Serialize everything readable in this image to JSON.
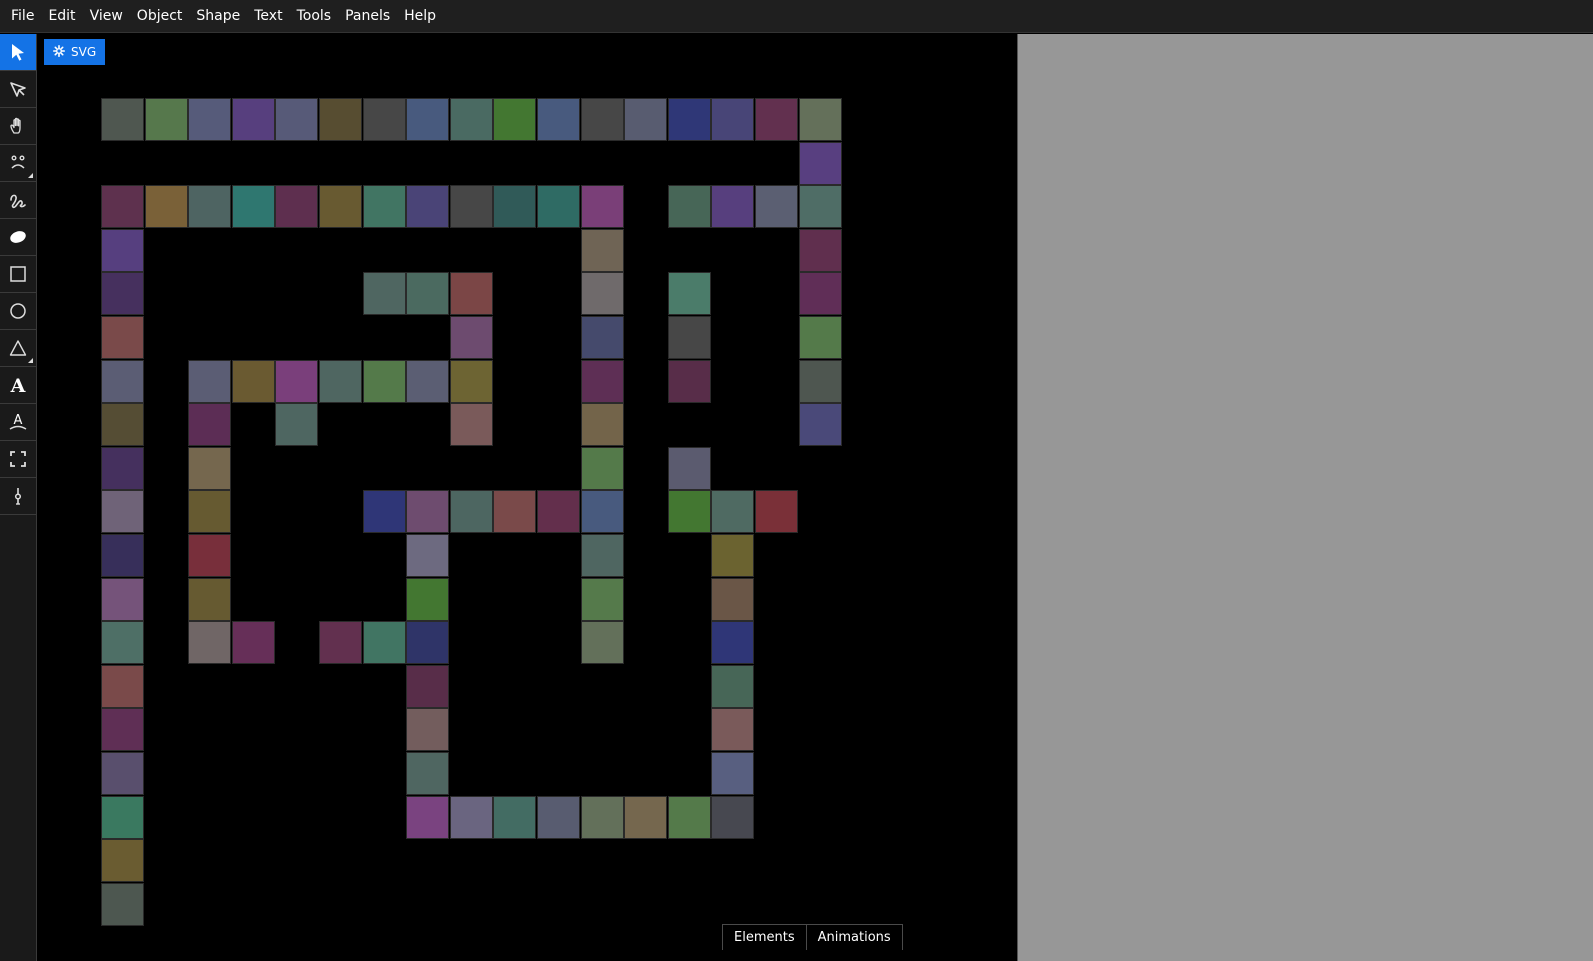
{
  "menu": [
    "File",
    "Edit",
    "View",
    "Object",
    "Shape",
    "Text",
    "Tools",
    "Panels",
    "Help"
  ],
  "tools": [
    {
      "name": "select-tool",
      "icon": "arrow-cursor-icon",
      "active": true
    },
    {
      "name": "direct-select-tool",
      "icon": "node-cursor-icon"
    },
    {
      "name": "pan-tool",
      "icon": "hand-icon"
    },
    {
      "name": "face-tool",
      "icon": "face-icon",
      "corner": true
    },
    {
      "name": "freehand-tool",
      "icon": "squiggle-icon"
    },
    {
      "name": "ellipse-fill-tool",
      "icon": "ellipse-icon"
    },
    {
      "name": "rectangle-tool",
      "icon": "square-icon"
    },
    {
      "name": "circle-tool",
      "icon": "circle-icon"
    },
    {
      "name": "triangle-tool",
      "icon": "triangle-icon",
      "corner": true
    },
    {
      "name": "text-tool",
      "icon": "letter-a-icon"
    },
    {
      "name": "text-on-path-tool",
      "icon": "curved-text-icon"
    },
    {
      "name": "fit-view-tool",
      "icon": "frame-corners-icon"
    },
    {
      "name": "pen-tool",
      "icon": "pen-nib-icon"
    }
  ],
  "badge": {
    "label": "SVG",
    "icon": "gear-icon"
  },
  "tabs": {
    "elements": "Elements",
    "animations": "Animations"
  },
  "canvas_tiles": [
    {
      "row": 0,
      "col": 0,
      "color": "#4f5750"
    },
    {
      "row": 0,
      "col": 1,
      "color": "#56784c"
    },
    {
      "row": 0,
      "col": 2,
      "color": "#565b7a"
    },
    {
      "row": 0,
      "col": 3,
      "color": "#573f7e"
    },
    {
      "row": 0,
      "col": 4,
      "color": "#575a78"
    },
    {
      "row": 0,
      "col": 5,
      "color": "#574d31"
    },
    {
      "row": 0,
      "col": 6,
      "color": "#474747"
    },
    {
      "row": 0,
      "col": 7,
      "color": "#485a7e"
    },
    {
      "row": 0,
      "col": 8,
      "color": "#4a6a62"
    },
    {
      "row": 0,
      "col": 9,
      "color": "#437731"
    },
    {
      "row": 0,
      "col": 10,
      "color": "#485a7e"
    },
    {
      "row": 0,
      "col": 11,
      "color": "#474747"
    },
    {
      "row": 0,
      "col": 12,
      "color": "#585c70"
    },
    {
      "row": 0,
      "col": 13,
      "color": "#2f3777"
    },
    {
      "row": 0,
      "col": 14,
      "color": "#484577"
    },
    {
      "row": 0,
      "col": 15,
      "color": "#62304f"
    },
    {
      "row": 0,
      "col": 16,
      "color": "#64705a"
    },
    {
      "row": 1,
      "col": 16,
      "color": "#583f80"
    },
    {
      "row": 2,
      "col": 0,
      "color": "#5e314e"
    },
    {
      "row": 2,
      "col": 1,
      "color": "#7a6138"
    },
    {
      "row": 2,
      "col": 2,
      "color": "#4e6462"
    },
    {
      "row": 2,
      "col": 3,
      "color": "#2f7770"
    },
    {
      "row": 2,
      "col": 4,
      "color": "#5e2f4f"
    },
    {
      "row": 2,
      "col": 5,
      "color": "#685a31"
    },
    {
      "row": 2,
      "col": 6,
      "color": "#417563"
    },
    {
      "row": 2,
      "col": 7,
      "color": "#4a4477"
    },
    {
      "row": 2,
      "col": 8,
      "color": "#474747"
    },
    {
      "row": 2,
      "col": 9,
      "color": "#305a58"
    },
    {
      "row": 2,
      "col": 10,
      "color": "#2f6b64"
    },
    {
      "row": 2,
      "col": 11,
      "color": "#7a3f78"
    },
    {
      "row": 2,
      "col": 13,
      "color": "#476657"
    },
    {
      "row": 2,
      "col": 14,
      "color": "#573f7e"
    },
    {
      "row": 2,
      "col": 15,
      "color": "#5b5f72"
    },
    {
      "row": 2,
      "col": 16,
      "color": "#4f6d66"
    },
    {
      "row": 3,
      "col": 0,
      "color": "#563f7f"
    },
    {
      "row": 3,
      "col": 11,
      "color": "#6f6455"
    },
    {
      "row": 3,
      "col": 16,
      "color": "#602f4e"
    },
    {
      "row": 4,
      "col": 0,
      "color": "#46305e"
    },
    {
      "row": 4,
      "col": 6,
      "color": "#4f6661"
    },
    {
      "row": 4,
      "col": 7,
      "color": "#4b6a60"
    },
    {
      "row": 4,
      "col": 8,
      "color": "#7b4646"
    },
    {
      "row": 4,
      "col": 11,
      "color": "#6f6a6b"
    },
    {
      "row": 4,
      "col": 13,
      "color": "#4b7c6a"
    },
    {
      "row": 4,
      "col": 16,
      "color": "#602e57"
    },
    {
      "row": 5,
      "col": 0,
      "color": "#7a4a4a"
    },
    {
      "row": 5,
      "col": 8,
      "color": "#6d4b6f"
    },
    {
      "row": 5,
      "col": 11,
      "color": "#454a6c"
    },
    {
      "row": 5,
      "col": 13,
      "color": "#474747"
    },
    {
      "row": 5,
      "col": 16,
      "color": "#547a4a"
    },
    {
      "row": 6,
      "col": 0,
      "color": "#5b5d74"
    },
    {
      "row": 6,
      "col": 2,
      "color": "#5b5d74"
    },
    {
      "row": 6,
      "col": 3,
      "color": "#6a5a31"
    },
    {
      "row": 6,
      "col": 4,
      "color": "#7a3f7b"
    },
    {
      "row": 6,
      "col": 5,
      "color": "#4f6661"
    },
    {
      "row": 6,
      "col": 6,
      "color": "#547a4a"
    },
    {
      "row": 6,
      "col": 7,
      "color": "#5b5e73"
    },
    {
      "row": 6,
      "col": 8,
      "color": "#6d6433"
    },
    {
      "row": 6,
      "col": 11,
      "color": "#5e2f55"
    },
    {
      "row": 6,
      "col": 13,
      "color": "#582d49"
    },
    {
      "row": 6,
      "col": 16,
      "color": "#4e5650"
    },
    {
      "row": 7,
      "col": 0,
      "color": "#554d34"
    },
    {
      "row": 7,
      "col": 2,
      "color": "#5c2d55"
    },
    {
      "row": 7,
      "col": 4,
      "color": "#4e6661"
    },
    {
      "row": 7,
      "col": 8,
      "color": "#7a5a5a"
    },
    {
      "row": 7,
      "col": 11,
      "color": "#73644a"
    },
    {
      "row": 7,
      "col": 16,
      "color": "#4a4979"
    },
    {
      "row": 8,
      "col": 0,
      "color": "#45305e"
    },
    {
      "row": 8,
      "col": 2,
      "color": "#75674e"
    },
    {
      "row": 8,
      "col": 11,
      "color": "#547a4a"
    },
    {
      "row": 8,
      "col": 13,
      "color": "#5b5b6f"
    },
    {
      "row": 9,
      "col": 0,
      "color": "#6f6378"
    },
    {
      "row": 9,
      "col": 2,
      "color": "#665a31"
    },
    {
      "row": 9,
      "col": 6,
      "color": "#2f3677"
    },
    {
      "row": 9,
      "col": 7,
      "color": "#6e4c6f"
    },
    {
      "row": 9,
      "col": 8,
      "color": "#4d6661"
    },
    {
      "row": 9,
      "col": 9,
      "color": "#7a4a4a"
    },
    {
      "row": 9,
      "col": 10,
      "color": "#632f4c"
    },
    {
      "row": 9,
      "col": 11,
      "color": "#485a7e"
    },
    {
      "row": 9,
      "col": 13,
      "color": "#437731"
    },
    {
      "row": 9,
      "col": 14,
      "color": "#4f6a62"
    },
    {
      "row": 9,
      "col": 15,
      "color": "#7a3038"
    },
    {
      "row": 10,
      "col": 0,
      "color": "#372f5a"
    },
    {
      "row": 10,
      "col": 2,
      "color": "#782f3b"
    },
    {
      "row": 10,
      "col": 7,
      "color": "#6d6a80"
    },
    {
      "row": 10,
      "col": 11,
      "color": "#4f6661"
    },
    {
      "row": 10,
      "col": 14,
      "color": "#6b6330"
    },
    {
      "row": 11,
      "col": 0,
      "color": "#75537a"
    },
    {
      "row": 11,
      "col": 2,
      "color": "#665a31"
    },
    {
      "row": 11,
      "col": 7,
      "color": "#437731"
    },
    {
      "row": 11,
      "col": 11,
      "color": "#557a4b"
    },
    {
      "row": 11,
      "col": 14,
      "color": "#6a5647"
    },
    {
      "row": 12,
      "col": 0,
      "color": "#4e6f66"
    },
    {
      "row": 12,
      "col": 2,
      "color": "#706666"
    },
    {
      "row": 12,
      "col": 3,
      "color": "#662f58"
    },
    {
      "row": 12,
      "col": 5,
      "color": "#62304f"
    },
    {
      "row": 12,
      "col": 6,
      "color": "#417563"
    },
    {
      "row": 12,
      "col": 7,
      "color": "#2f3468"
    },
    {
      "row": 12,
      "col": 11,
      "color": "#63705a"
    },
    {
      "row": 12,
      "col": 14,
      "color": "#2f3677"
    },
    {
      "row": 13,
      "col": 0,
      "color": "#7a4a4a"
    },
    {
      "row": 13,
      "col": 7,
      "color": "#582d49"
    },
    {
      "row": 13,
      "col": 14,
      "color": "#476657"
    },
    {
      "row": 14,
      "col": 0,
      "color": "#5f2f55"
    },
    {
      "row": 14,
      "col": 7,
      "color": "#735d5d"
    },
    {
      "row": 14,
      "col": 14,
      "color": "#7a5a5a"
    },
    {
      "row": 15,
      "col": 0,
      "color": "#594f6d"
    },
    {
      "row": 15,
      "col": 7,
      "color": "#4f6661"
    },
    {
      "row": 15,
      "col": 14,
      "color": "#585f80"
    },
    {
      "row": 16,
      "col": 0,
      "color": "#3a7960"
    },
    {
      "row": 16,
      "col": 7,
      "color": "#7a4380"
    },
    {
      "row": 16,
      "col": 8,
      "color": "#6a6580"
    },
    {
      "row": 16,
      "col": 9,
      "color": "#436c63"
    },
    {
      "row": 16,
      "col": 10,
      "color": "#585c70"
    },
    {
      "row": 16,
      "col": 11,
      "color": "#63705a"
    },
    {
      "row": 16,
      "col": 12,
      "color": "#75674e"
    },
    {
      "row": 16,
      "col": 13,
      "color": "#547a4a"
    },
    {
      "row": 16,
      "col": 14,
      "color": "#474850"
    },
    {
      "row": 17,
      "col": 0,
      "color": "#6a5c31"
    },
    {
      "row": 18,
      "col": 0,
      "color": "#4d5750"
    }
  ]
}
